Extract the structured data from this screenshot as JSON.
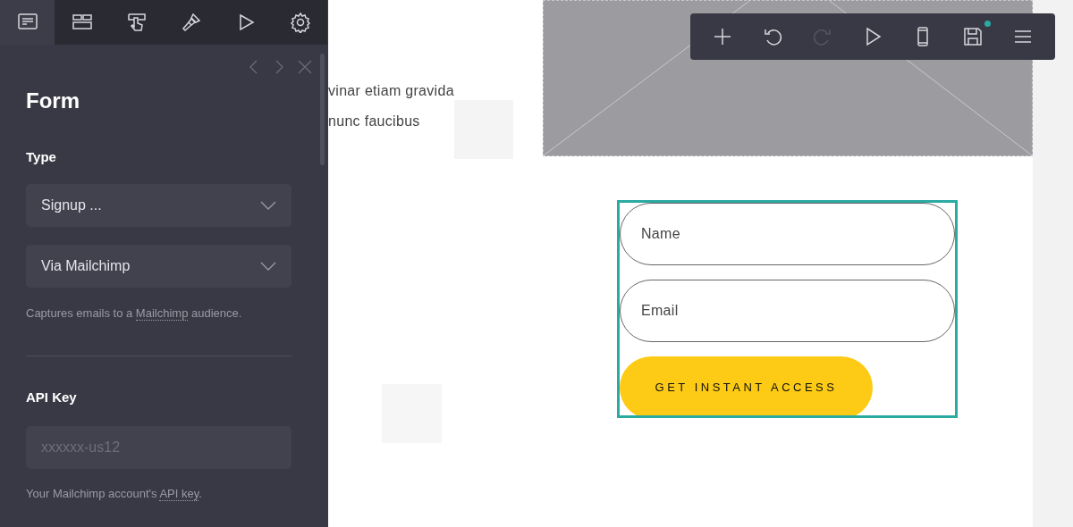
{
  "panel_tabs": [
    {
      "kind": "content",
      "selected": true
    },
    {
      "kind": "layout",
      "selected": false
    },
    {
      "kind": "interact",
      "selected": false
    },
    {
      "kind": "style",
      "selected": false
    },
    {
      "kind": "preview",
      "selected": false
    },
    {
      "kind": "settings",
      "selected": false
    }
  ],
  "panel": {
    "title": "Form",
    "type_label": "Type",
    "selects": [
      {
        "value": "Signup ..."
      },
      {
        "value": "Via Mailchimp"
      }
    ],
    "type_help": {
      "before": "Captures emails to a ",
      "link": "Mailchimp",
      "after": " audience."
    },
    "api_label": "API Key",
    "api_field": {
      "placeholder": "xxxxxx-us12"
    },
    "api_help": {
      "before": "Your Mailchimp account's ",
      "link": "API key",
      "after": "."
    }
  },
  "canvas": {
    "text_lines": [
      "vinar etiam gravida",
      "nunc faucibus"
    ],
    "form": {
      "fields": [
        {
          "placeholder": "Name"
        },
        {
          "placeholder": "Email"
        }
      ],
      "button": "GET INSTANT ACCESS",
      "selected": true
    }
  },
  "toolbar": [
    {
      "kind": "add",
      "disabled": false,
      "unsaved": false
    },
    {
      "kind": "undo",
      "disabled": false,
      "unsaved": false
    },
    {
      "kind": "redo",
      "disabled": true,
      "unsaved": false
    },
    {
      "kind": "play",
      "disabled": false,
      "unsaved": false
    },
    {
      "kind": "mobile",
      "disabled": false,
      "unsaved": false
    },
    {
      "kind": "save",
      "disabled": false,
      "unsaved": true
    },
    {
      "kind": "menu",
      "disabled": false,
      "unsaved": false
    }
  ]
}
